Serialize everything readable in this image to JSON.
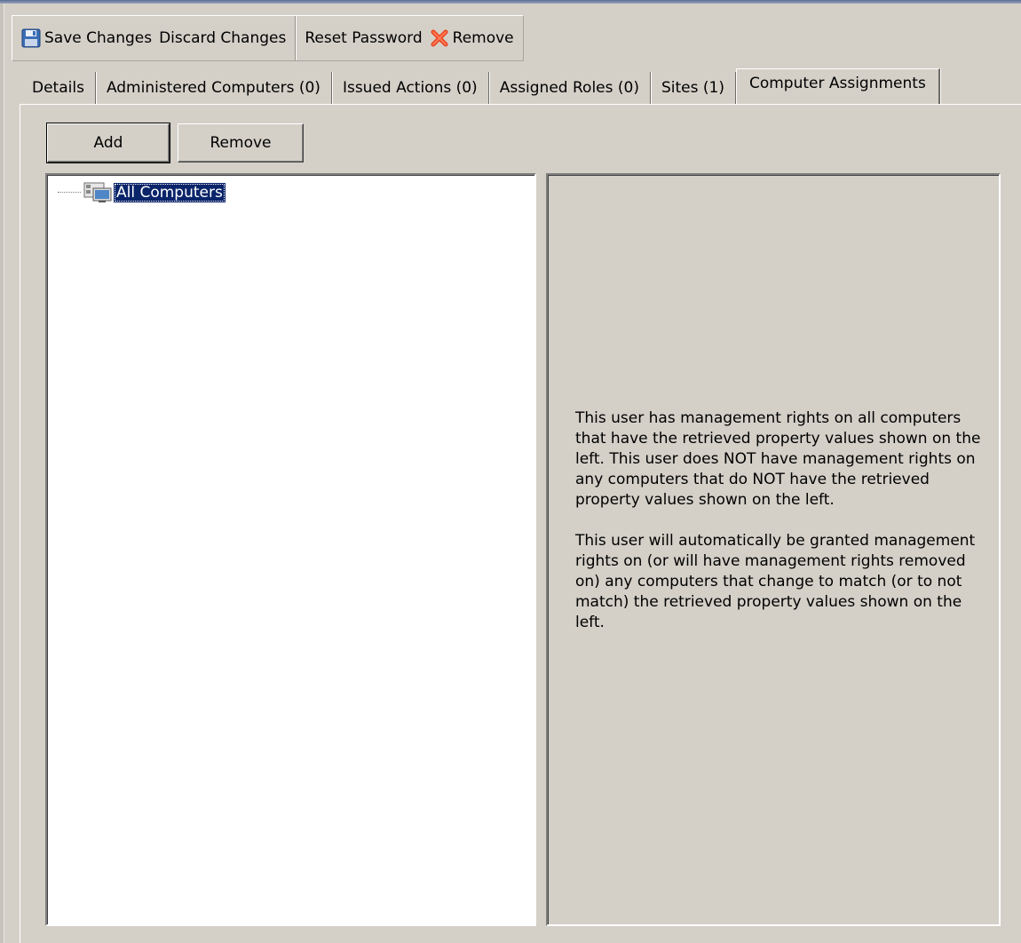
{
  "toolbar": {
    "save_label": "Save Changes",
    "discard_label": "Discard Changes",
    "reset_password_label": "Reset Password",
    "remove_label": "Remove",
    "save_icon": "floppy-disk-icon",
    "remove_icon": "red-x-icon"
  },
  "tabs": [
    {
      "label": "Details",
      "active": false
    },
    {
      "label": "Administered Computers (0)",
      "active": false
    },
    {
      "label": "Issued Actions (0)",
      "active": false
    },
    {
      "label": "Assigned Roles (0)",
      "active": false
    },
    {
      "label": "Sites (1)",
      "active": false
    },
    {
      "label": "Computer Assignments",
      "active": true
    }
  ],
  "buttons": {
    "add_label": "Add",
    "remove_label": "Remove"
  },
  "tree": {
    "items": [
      {
        "label": "All Computers",
        "icon": "computer-group-icon",
        "selected": true
      }
    ]
  },
  "info": {
    "paragraph1": "This user has management rights on all computers that have the retrieved property values shown on the left. This user does NOT have management rights on any computers that do NOT have the retrieved property values shown on the left.",
    "paragraph2": "This user will automatically be granted management rights on (or will have management rights removed on) any computers that change to match (or to not match) the retrieved property values shown on the left."
  },
  "colors": {
    "window_bg": "#d4d0c8",
    "selection": "#0a246a",
    "remove_icon": "#e8421e"
  }
}
